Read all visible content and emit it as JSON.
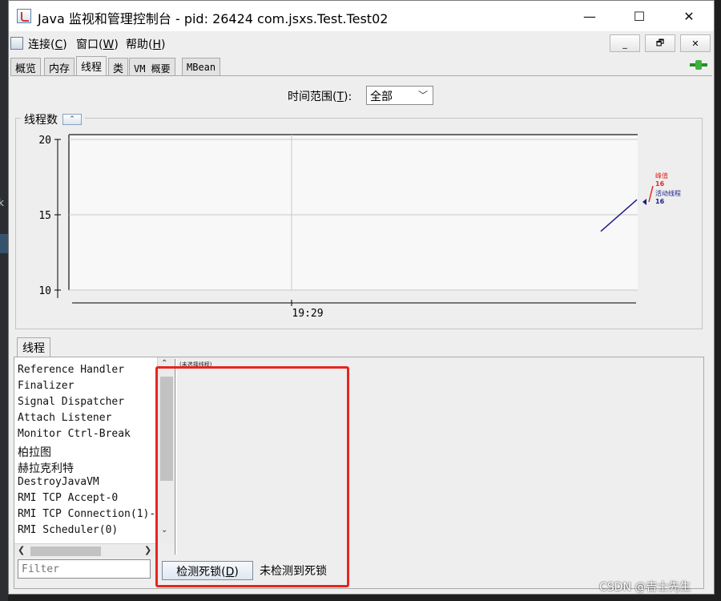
{
  "window": {
    "title": "Java 监视和管理控制台 - pid: 26424 com.jsxs.Test.Test02",
    "controls": {
      "minimize": "—",
      "maximize": "☐",
      "close": "✕"
    },
    "mdi_controls": {
      "minimize": "_",
      "restore": "🗗",
      "close": "✕"
    }
  },
  "menu": {
    "connect": {
      "label": "连接",
      "mnemonic": "C"
    },
    "window": {
      "label": "窗口",
      "mnemonic": "W"
    },
    "help": {
      "label": "帮助",
      "mnemonic": "H"
    }
  },
  "tabs": [
    {
      "label": "概览"
    },
    {
      "label": "内存"
    },
    {
      "label": "线程"
    },
    {
      "label": "类"
    },
    {
      "label": "VM 概要"
    },
    {
      "label": "MBean"
    }
  ],
  "active_tab": "线程",
  "time_range": {
    "label": "时间范围",
    "mnemonic": "T",
    "selected": "全部",
    "suffix": ":"
  },
  "chart_panel": {
    "title": "线程数",
    "collapse_symbol": "⌃"
  },
  "chart_data": {
    "type": "line",
    "y_ticks": [
      "20",
      "15",
      "10"
    ],
    "ylim": [
      10,
      20
    ],
    "x_ticks": [
      "19:29"
    ],
    "grid": true,
    "legend": [
      {
        "name": "峰值",
        "value": "16",
        "color": "#e8251d"
      },
      {
        "name": "活动线程",
        "value": "16",
        "color": "#1c1c8c"
      }
    ],
    "series": [
      {
        "name": "活动线程",
        "color": "#1c1c8c",
        "y_start": 13.9,
        "y_end": 16
      }
    ]
  },
  "threads_tab": {
    "label": "线程"
  },
  "threads": [
    "Reference Handler",
    "Finalizer",
    "Signal Dispatcher",
    "Attach Listener",
    "Monitor Ctrl-Break",
    "柏拉图",
    "赫拉克利特",
    "DestroyJavaVM",
    "RMI TCP Accept-0",
    "RMI TCP Connection(1)-",
    "RMI Scheduler(0)"
  ],
  "details_placeholder": "(未选择线程)",
  "filter": {
    "placeholder": "Filter"
  },
  "deadlock": {
    "button_label": "检测死锁",
    "button_mnemonic": "D",
    "status": "未检测到死锁"
  },
  "watermark": "CSDN @吉士先生"
}
